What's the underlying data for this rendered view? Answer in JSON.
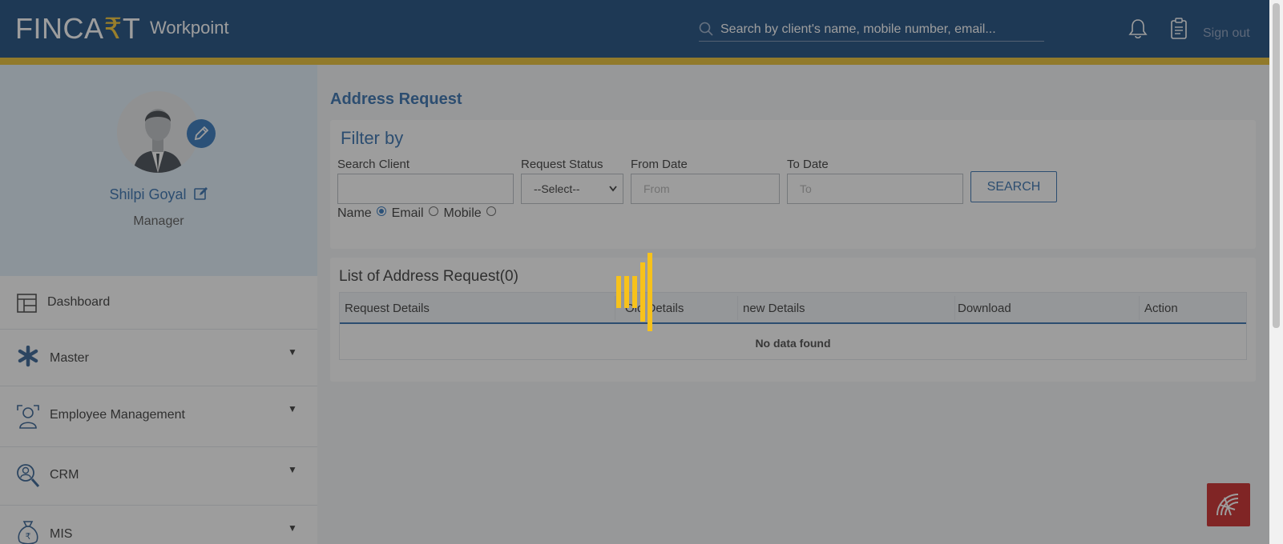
{
  "header": {
    "logo_prefix": "FINCA",
    "logo_accent": "₹",
    "logo_suffix": "T",
    "app_name": "Workpoint",
    "search_placeholder": "Search by client's name,  mobile number, email...",
    "signout_label": "Sign out",
    "colors": {
      "bar": "#00366e",
      "strip": "#e6b91a"
    }
  },
  "sidebar": {
    "profile": {
      "name": "Shilpi Goyal",
      "role": "Manager"
    },
    "items": [
      {
        "label": "Dashboard",
        "icon": "dashboard-icon",
        "has_caret": false
      },
      {
        "label": "Master",
        "icon": "asterisk-icon",
        "has_caret": true
      },
      {
        "label": "Employee Management",
        "icon": "employee-icon",
        "has_caret": true
      },
      {
        "label": "CRM",
        "icon": "crm-search-icon",
        "has_caret": true
      },
      {
        "label": "MIS",
        "icon": "money-bag-icon",
        "has_caret": true
      }
    ],
    "caret": "▼"
  },
  "main": {
    "page_title": "Address Request",
    "filter": {
      "title": "Filter by",
      "search_client_label": "Search Client",
      "request_status_label": "Request Status",
      "request_status_value": "--Select--",
      "from_date_label": "From Date",
      "from_placeholder": "From",
      "to_date_label": "To Date",
      "to_placeholder": "To",
      "search_button": "SEARCH",
      "radio_options": [
        "Name",
        "Email",
        "Mobile"
      ],
      "radio_selected": "Name"
    },
    "list": {
      "title": "List of Address Request(0)",
      "columns": [
        "Request Details",
        "Old Details",
        "new Details",
        "Download",
        "Action"
      ],
      "empty_message": "No data found"
    }
  },
  "colors": {
    "accent": "#1c5fa5",
    "loader": "#f7c21b",
    "help_button": "#c50f0f"
  }
}
